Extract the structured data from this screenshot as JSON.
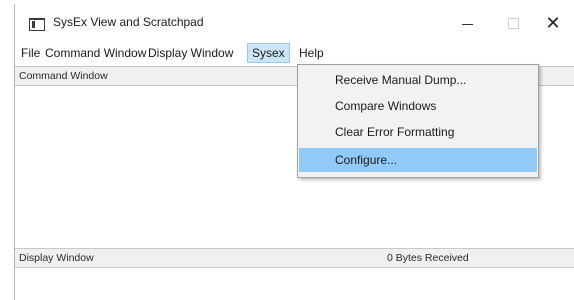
{
  "window": {
    "title": "SysEx View and Scratchpad",
    "icon": "app-window-icon",
    "controls": {
      "minimize": "minimize",
      "maximize": "maximize",
      "close": "✕"
    }
  },
  "menubar": {
    "items": [
      "File",
      "Command Window",
      "Display Window",
      "Sysex",
      "Help"
    ],
    "active": "Sysex"
  },
  "sysex_menu": {
    "items": [
      "Receive Manual Dump...",
      "Compare Windows",
      "Clear Error Formatting",
      "Configure..."
    ],
    "highlighted": "Configure..."
  },
  "command_pane": {
    "header": "Command Window"
  },
  "display_pane": {
    "header": "Display Window",
    "status": "0  Bytes Received"
  },
  "colors": {
    "menu_highlight": "#91c9f7",
    "active_menu": "#cce4f7",
    "pane_header_bg": "#f0f0f0"
  }
}
